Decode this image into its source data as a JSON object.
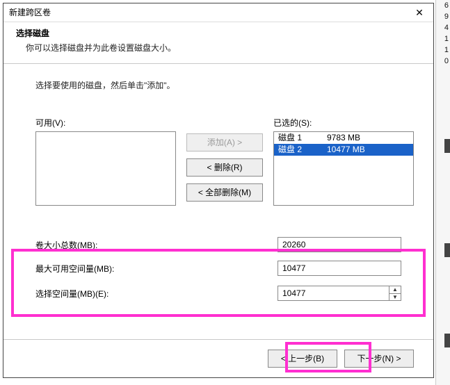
{
  "window": {
    "title": "新建跨区卷",
    "close_glyph": "✕"
  },
  "header": {
    "title": "选择磁盘",
    "subtitle": "你可以选择磁盘并为此卷设置磁盘大小。"
  },
  "instruction": "选择要使用的磁盘，然后单击\"添加\"。",
  "available": {
    "label": "可用(V):",
    "items": []
  },
  "selected": {
    "label": "已选的(S):",
    "items": [
      {
        "name": "磁盘 1",
        "size": "9783 MB",
        "selected": false
      },
      {
        "name": "磁盘 2",
        "size": "10477 MB",
        "selected": true
      }
    ]
  },
  "buttons": {
    "add": "添加(A) >",
    "remove": "< 删除(R)",
    "remove_all": "< 全部删除(M)"
  },
  "fields": {
    "total_label": "卷大小总数(MB):",
    "total_value": "20260",
    "max_label": "最大可用空间量(MB):",
    "max_value": "10477",
    "select_label": "选择空间量(MB)(E):",
    "select_value": "10477"
  },
  "footer": {
    "back": "< 上一步(B)",
    "next": "下一步(N) >"
  },
  "gutter_numbers": [
    "6",
    "9",
    "4",
    "1",
    "1",
    "0"
  ]
}
